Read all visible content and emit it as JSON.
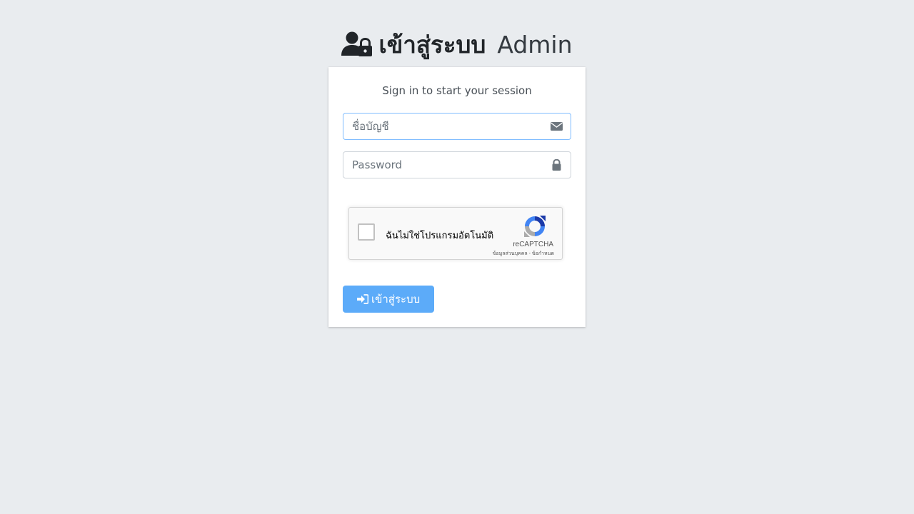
{
  "header": {
    "title_strong": "เข้าสู่ระบบ",
    "title_light": "Admin",
    "icon": "user-lock-icon"
  },
  "card": {
    "message": "Sign in to start your session"
  },
  "form": {
    "username": {
      "placeholder": "ชื่อบัญชี",
      "value": "",
      "icon": "envelope-icon"
    },
    "password": {
      "placeholder": "Password",
      "value": "",
      "icon": "lock-icon"
    },
    "recaptcha": {
      "label": "ฉันไม่ใช่โปรแกรมอัตโนมัติ",
      "brand": "reCAPTCHA",
      "links": "ข้อมูลส่วนบุคคล - ข้อกำหนด"
    },
    "submit": {
      "label": "เข้าสู่ระบบ",
      "icon": "sign-in-icon"
    }
  },
  "colors": {
    "background": "#e9ecef",
    "primary_button": "#5cabf9",
    "focus_border": "#80bdff"
  }
}
